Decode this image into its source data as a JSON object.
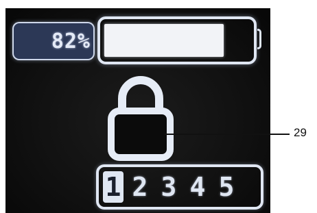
{
  "battery": {
    "percent_label": "82%",
    "level": 0.82
  },
  "lock": {
    "icon": "padlock-locked-icon",
    "state": "locked"
  },
  "slots": {
    "items": [
      {
        "label": "1",
        "selected": true
      },
      {
        "label": "2",
        "selected": false
      },
      {
        "label": "3",
        "selected": false
      },
      {
        "label": "4",
        "selected": false
      },
      {
        "label": "5",
        "selected": false
      }
    ]
  },
  "callout": {
    "label": "29"
  },
  "colors": {
    "screen_bg": "#111111",
    "display_fg": "#dfe6f2",
    "percent_bg": "#2c3856"
  }
}
